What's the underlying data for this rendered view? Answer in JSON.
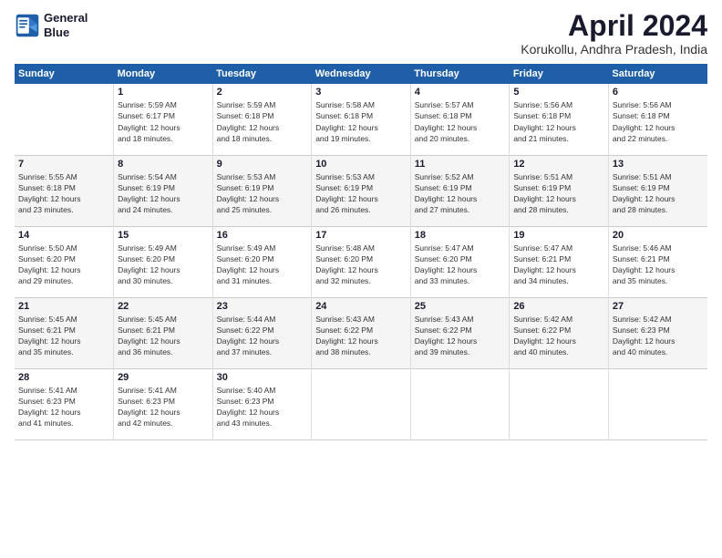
{
  "header": {
    "logo_line1": "General",
    "logo_line2": "Blue",
    "month": "April 2024",
    "location": "Korukollu, Andhra Pradesh, India"
  },
  "days_of_week": [
    "Sunday",
    "Monday",
    "Tuesday",
    "Wednesday",
    "Thursday",
    "Friday",
    "Saturday"
  ],
  "weeks": [
    [
      {
        "day": "",
        "info": ""
      },
      {
        "day": "1",
        "info": "Sunrise: 5:59 AM\nSunset: 6:17 PM\nDaylight: 12 hours\nand 18 minutes."
      },
      {
        "day": "2",
        "info": "Sunrise: 5:59 AM\nSunset: 6:18 PM\nDaylight: 12 hours\nand 18 minutes."
      },
      {
        "day": "3",
        "info": "Sunrise: 5:58 AM\nSunset: 6:18 PM\nDaylight: 12 hours\nand 19 minutes."
      },
      {
        "day": "4",
        "info": "Sunrise: 5:57 AM\nSunset: 6:18 PM\nDaylight: 12 hours\nand 20 minutes."
      },
      {
        "day": "5",
        "info": "Sunrise: 5:56 AM\nSunset: 6:18 PM\nDaylight: 12 hours\nand 21 minutes."
      },
      {
        "day": "6",
        "info": "Sunrise: 5:56 AM\nSunset: 6:18 PM\nDaylight: 12 hours\nand 22 minutes."
      }
    ],
    [
      {
        "day": "7",
        "info": "Sunrise: 5:55 AM\nSunset: 6:18 PM\nDaylight: 12 hours\nand 23 minutes."
      },
      {
        "day": "8",
        "info": "Sunrise: 5:54 AM\nSunset: 6:19 PM\nDaylight: 12 hours\nand 24 minutes."
      },
      {
        "day": "9",
        "info": "Sunrise: 5:53 AM\nSunset: 6:19 PM\nDaylight: 12 hours\nand 25 minutes."
      },
      {
        "day": "10",
        "info": "Sunrise: 5:53 AM\nSunset: 6:19 PM\nDaylight: 12 hours\nand 26 minutes."
      },
      {
        "day": "11",
        "info": "Sunrise: 5:52 AM\nSunset: 6:19 PM\nDaylight: 12 hours\nand 27 minutes."
      },
      {
        "day": "12",
        "info": "Sunrise: 5:51 AM\nSunset: 6:19 PM\nDaylight: 12 hours\nand 28 minutes."
      },
      {
        "day": "13",
        "info": "Sunrise: 5:51 AM\nSunset: 6:19 PM\nDaylight: 12 hours\nand 28 minutes."
      }
    ],
    [
      {
        "day": "14",
        "info": "Sunrise: 5:50 AM\nSunset: 6:20 PM\nDaylight: 12 hours\nand 29 minutes."
      },
      {
        "day": "15",
        "info": "Sunrise: 5:49 AM\nSunset: 6:20 PM\nDaylight: 12 hours\nand 30 minutes."
      },
      {
        "day": "16",
        "info": "Sunrise: 5:49 AM\nSunset: 6:20 PM\nDaylight: 12 hours\nand 31 minutes."
      },
      {
        "day": "17",
        "info": "Sunrise: 5:48 AM\nSunset: 6:20 PM\nDaylight: 12 hours\nand 32 minutes."
      },
      {
        "day": "18",
        "info": "Sunrise: 5:47 AM\nSunset: 6:20 PM\nDaylight: 12 hours\nand 33 minutes."
      },
      {
        "day": "19",
        "info": "Sunrise: 5:47 AM\nSunset: 6:21 PM\nDaylight: 12 hours\nand 34 minutes."
      },
      {
        "day": "20",
        "info": "Sunrise: 5:46 AM\nSunset: 6:21 PM\nDaylight: 12 hours\nand 35 minutes."
      }
    ],
    [
      {
        "day": "21",
        "info": "Sunrise: 5:45 AM\nSunset: 6:21 PM\nDaylight: 12 hours\nand 35 minutes."
      },
      {
        "day": "22",
        "info": "Sunrise: 5:45 AM\nSunset: 6:21 PM\nDaylight: 12 hours\nand 36 minutes."
      },
      {
        "day": "23",
        "info": "Sunrise: 5:44 AM\nSunset: 6:22 PM\nDaylight: 12 hours\nand 37 minutes."
      },
      {
        "day": "24",
        "info": "Sunrise: 5:43 AM\nSunset: 6:22 PM\nDaylight: 12 hours\nand 38 minutes."
      },
      {
        "day": "25",
        "info": "Sunrise: 5:43 AM\nSunset: 6:22 PM\nDaylight: 12 hours\nand 39 minutes."
      },
      {
        "day": "26",
        "info": "Sunrise: 5:42 AM\nSunset: 6:22 PM\nDaylight: 12 hours\nand 40 minutes."
      },
      {
        "day": "27",
        "info": "Sunrise: 5:42 AM\nSunset: 6:23 PM\nDaylight: 12 hours\nand 40 minutes."
      }
    ],
    [
      {
        "day": "28",
        "info": "Sunrise: 5:41 AM\nSunset: 6:23 PM\nDaylight: 12 hours\nand 41 minutes."
      },
      {
        "day": "29",
        "info": "Sunrise: 5:41 AM\nSunset: 6:23 PM\nDaylight: 12 hours\nand 42 minutes."
      },
      {
        "day": "30",
        "info": "Sunrise: 5:40 AM\nSunset: 6:23 PM\nDaylight: 12 hours\nand 43 minutes."
      },
      {
        "day": "",
        "info": ""
      },
      {
        "day": "",
        "info": ""
      },
      {
        "day": "",
        "info": ""
      },
      {
        "day": "",
        "info": ""
      }
    ]
  ]
}
